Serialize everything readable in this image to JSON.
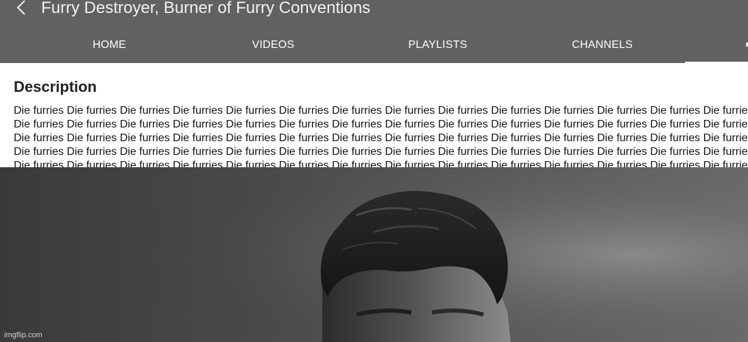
{
  "header": {
    "back_icon": "chevron-left-icon",
    "channel_title": "Furry Destroyer, Burner of Furry Conventions"
  },
  "tabs": [
    {
      "label": "HOME"
    },
    {
      "label": "VIDEOS"
    },
    {
      "label": "PLAYLISTS"
    },
    {
      "label": "CHANNELS"
    }
  ],
  "description": {
    "heading": "Description",
    "text": "Die furries Die furries Die furries Die furries Die furries Die furries Die furries Die furries Die furries Die furries Die furries Die furries Die furries Die furries Die furries Die furries Die furries Die furries Die furries Die furries Die furries Die furries Die furries Die furries Die furries Die furries Die furries Die furries Die furries Die furries Die furries Die furries Die furries Die furries Die furries Die furries Die furries Die furries Die furries Die furries Die furries Die furries Die furries Die furries Die furries Die furries Die furries Die furries Die furries Die furries Die furries Die furries Die furries Die furries Die furries Die furries Die furries Die furries Die furries Die furries Die furries Die furries Die furries Die furries Die furries Die furries Die furries Die furries Die furries Die furries Die furries Die furries Die furries Die furries"
  },
  "photo": {
    "watermark": "imgflip.com"
  },
  "colors": {
    "appbar_bg": "#616161",
    "text_white": "#ffffff",
    "body_text": "#111111"
  }
}
